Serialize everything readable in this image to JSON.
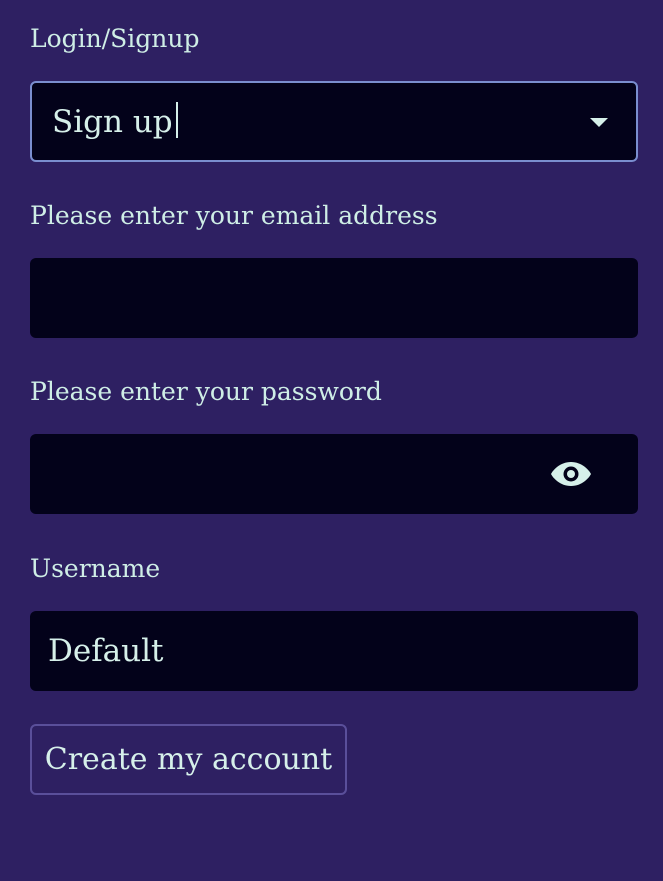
{
  "form": {
    "mode": {
      "label": "Login/Signup",
      "value": "Sign up",
      "icon": "chevron-down-icon"
    },
    "email": {
      "label": "Please enter your email address",
      "value": ""
    },
    "password": {
      "label": "Please enter your password",
      "value": "",
      "icon": "eye-icon"
    },
    "username": {
      "label": "Username",
      "value": "Default"
    },
    "submit_label": "Create my account"
  },
  "colors": {
    "background": "#2e2062",
    "field_background": "#03021a",
    "text": "#d6f0ea",
    "focus_border": "#7a8ecf"
  }
}
